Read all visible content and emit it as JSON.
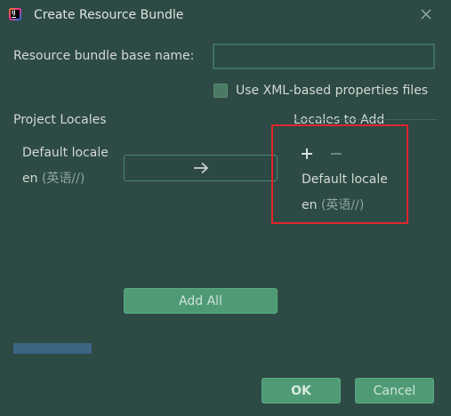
{
  "window": {
    "title": "Create Resource Bundle",
    "app_icon": "intellij-idea-icon",
    "app_icon_text": "IJ",
    "close_icon": "close-icon"
  },
  "form": {
    "base_name_label": "Resource bundle base name:",
    "base_name_value": "",
    "xml_checkbox_label": "Use XML-based properties files",
    "xml_checkbox_checked": true
  },
  "project_locales": {
    "header": "Project Locales",
    "items": [
      {
        "name": "Default locale"
      },
      {
        "code": "en",
        "native": "(英语//)"
      }
    ]
  },
  "move_button_icon": "arrow-right-icon",
  "locales_to_add": {
    "header": "Locales to Add",
    "add_icon": "plus-icon",
    "remove_icon": "minus-icon",
    "items": [
      {
        "name": "Default locale"
      },
      {
        "code": "en",
        "native": "(英语//)"
      }
    ]
  },
  "buttons": {
    "add_all": "Add All",
    "ok": "OK",
    "cancel": "Cancel"
  },
  "colors": {
    "background": "#2d4a45",
    "primary_button": "#4f9b76",
    "highlight_border": "#e1262c",
    "scrollbar": "#3d6584"
  }
}
